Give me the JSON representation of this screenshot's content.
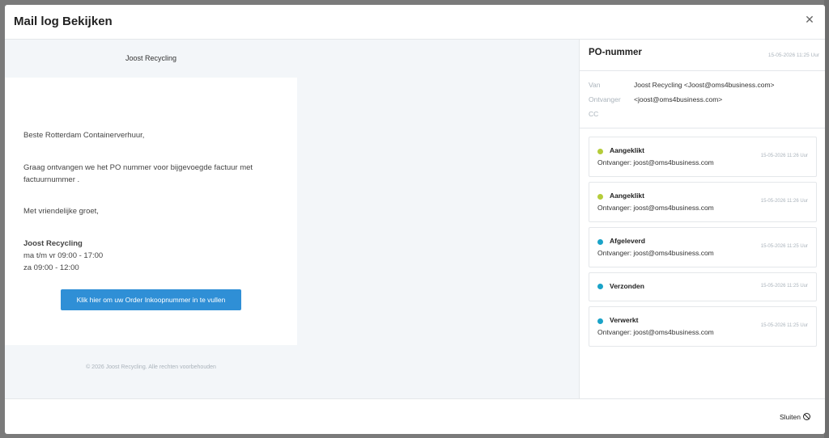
{
  "modal": {
    "title": "Mail log Bekijken",
    "close_icon": "close-icon"
  },
  "email": {
    "brand": "Joost Recycling",
    "greeting": "Beste Rotterdam Containerverhuur,",
    "body": "Graag ontvangen we het PO nummer voor bijgevoegde factuur met factuurnummer .",
    "closing": "Met vriendelijke groet,",
    "signature_name": "Joost Recycling",
    "hours_weekdays": "ma t/m vr 09:00 - 17:00",
    "hours_saturday": "za 09:00 - 12:00",
    "cta_label": "Klik hier om uw Order Inkoopnummer in te vullen",
    "footer": "© 2026 Joost Recycling. Alle rechten voorbehouden"
  },
  "panel": {
    "subject": "PO-nummer",
    "date": "15-05-2026 11:25 Uur",
    "meta": {
      "from_label": "Van",
      "from_value": "Joost Recycling <Joost@oms4business.com>",
      "to_label": "Ontvanger",
      "to_value": "<joost@oms4business.com>",
      "cc_label": "CC",
      "cc_value": ""
    },
    "events": [
      {
        "status": "Aangeklikt",
        "recipient": "Ontvanger: joost@oms4business.com",
        "date": "15-05-2026 11:26 Uur",
        "color": "#b5cc3a"
      },
      {
        "status": "Aangeklikt",
        "recipient": "Ontvanger: joost@oms4business.com",
        "date": "15-05-2026 11:26 Uur",
        "color": "#b5cc3a"
      },
      {
        "status": "Afgeleverd",
        "recipient": "Ontvanger: joost@oms4business.com",
        "date": "15-05-2026 11:25 Uur",
        "color": "#1aa3c8"
      },
      {
        "status": "Verzonden",
        "recipient": "",
        "date": "15-05-2026 11:25 Uur",
        "color": "#1aa3c8"
      },
      {
        "status": "Verwerkt",
        "recipient": "Ontvanger: joost@oms4business.com",
        "date": "15-05-2026 11:25 Uur",
        "color": "#1aa3c8"
      }
    ]
  },
  "footer": {
    "close_label": "Sluiten",
    "close_icon": "ban-icon"
  },
  "colors": {
    "accent": "#2f8fd6",
    "clicked": "#b5cc3a",
    "delivered": "#1aa3c8"
  }
}
